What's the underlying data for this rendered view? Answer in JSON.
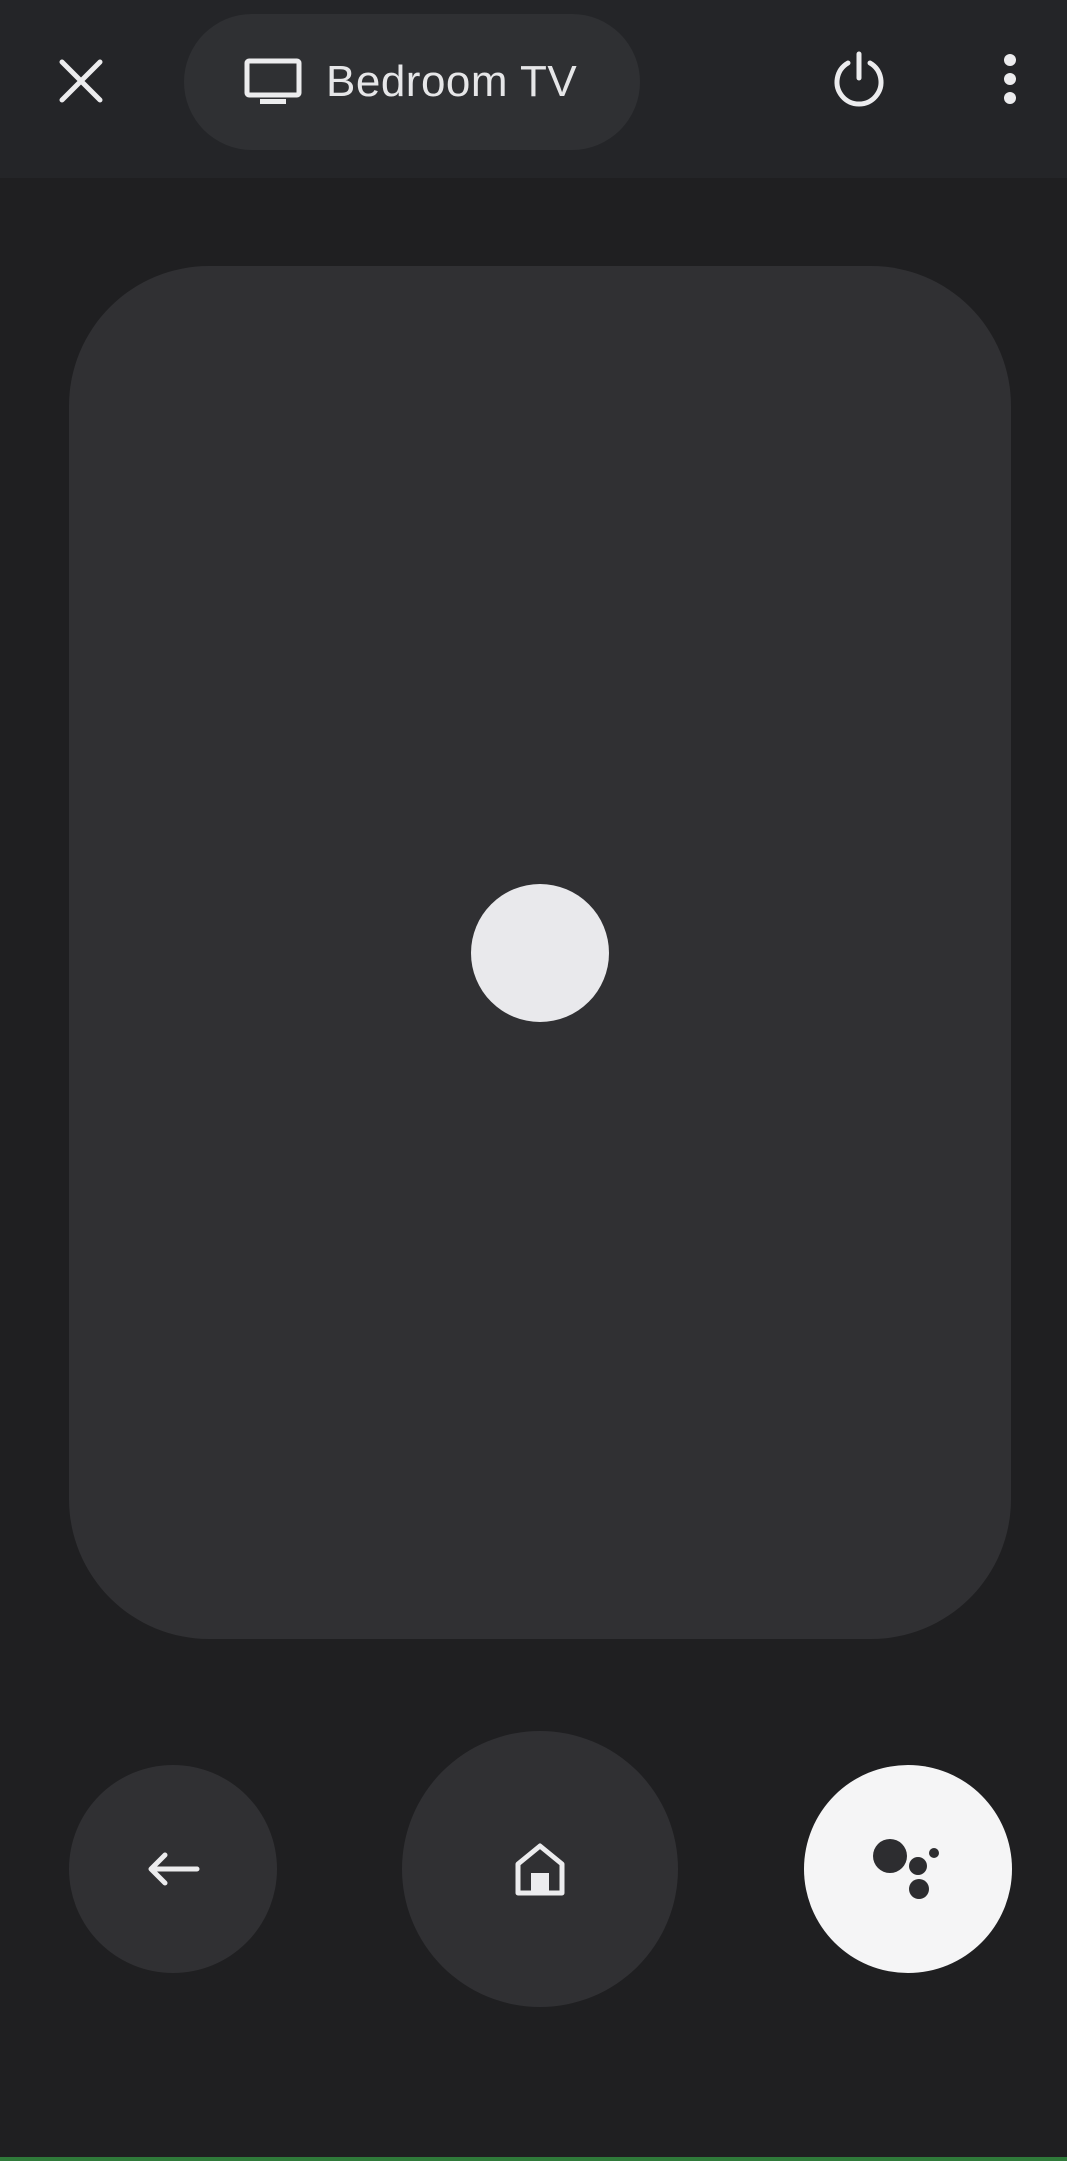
{
  "header": {
    "device_name": "Bedroom TV",
    "icons": {
      "close": "close-icon",
      "device": "tv-icon",
      "power": "power-icon",
      "more": "more-vert-icon"
    }
  },
  "touchpad": {
    "indicator": "touch-indicator"
  },
  "controls": {
    "back": "back-arrow-icon",
    "home": "home-icon",
    "assistant": "google-assistant-icon"
  },
  "colors": {
    "background": "#1f1f21",
    "top_bar": "#242528",
    "surface": "#303033",
    "indicator": "#e9e9ec",
    "assistant_button": "#f5f5f6",
    "icon_light": "#ececee",
    "icon_dark": "#2d2d30"
  }
}
